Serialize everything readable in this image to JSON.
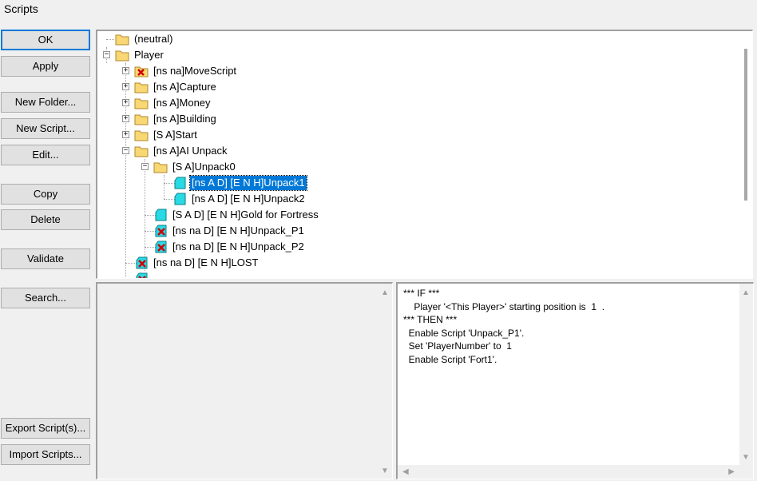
{
  "window": {
    "title": "Scripts"
  },
  "buttons": {
    "ok": "OK",
    "apply": "Apply",
    "new_folder": "New Folder...",
    "new_script": "New Script...",
    "edit": "Edit...",
    "copy": "Copy",
    "delete": "Delete",
    "validate": "Validate",
    "search": "Search...",
    "export": "Export Script(s)...",
    "import": "Import Scripts..."
  },
  "tree": {
    "nodes": [
      {
        "label": "(neutral)",
        "icon": "folder-icon"
      },
      {
        "label": "Player",
        "icon": "folder-icon",
        "expander": "minus"
      },
      {
        "label": "[ns na]MoveScript",
        "icon": "folder-disabled-icon",
        "expander": "plus"
      },
      {
        "label": "[ns A]Capture",
        "icon": "folder-icon",
        "expander": "plus"
      },
      {
        "label": "[ns A]Money",
        "icon": "folder-icon",
        "expander": "plus"
      },
      {
        "label": "[ns A]Building",
        "icon": "folder-icon",
        "expander": "plus"
      },
      {
        "label": "[S A]Start",
        "icon": "folder-icon",
        "expander": "plus"
      },
      {
        "label": "[ns A]AI Unpack",
        "icon": "folder-icon",
        "expander": "minus"
      },
      {
        "label": "[S A]Unpack0",
        "icon": "folder-icon",
        "expander": "minus"
      },
      {
        "label": "[ns A D]  [E N H]Unpack1",
        "icon": "script-icon",
        "selected": true
      },
      {
        "label": "[ns A D]  [E N H]Unpack2",
        "icon": "script-icon"
      },
      {
        "label": "[S A D]  [E N H]Gold for Fortress",
        "icon": "script-icon"
      },
      {
        "label": "[ns na D]  [E N H]Unpack_P1",
        "icon": "script-disabled-icon"
      },
      {
        "label": "[ns na D]  [E N H]Unpack_P2",
        "icon": "script-disabled-icon"
      },
      {
        "label": "[ns na D]  [E N H]LOST",
        "icon": "script-disabled-icon"
      }
    ]
  },
  "script_text": {
    "lines": [
      "*** IF ***",
      "    Player '<This Player>' starting position is  1  .",
      "*** THEN ***",
      "  Enable Script 'Unpack_P1'.",
      "  Set 'PlayerNumber' to  1",
      "  Enable Script 'Fort1'."
    ]
  },
  "colors": {
    "selection": "#0078d7",
    "folder": "#f8d775",
    "script": "#29d9e3",
    "disabled_mark": "#d00000"
  }
}
